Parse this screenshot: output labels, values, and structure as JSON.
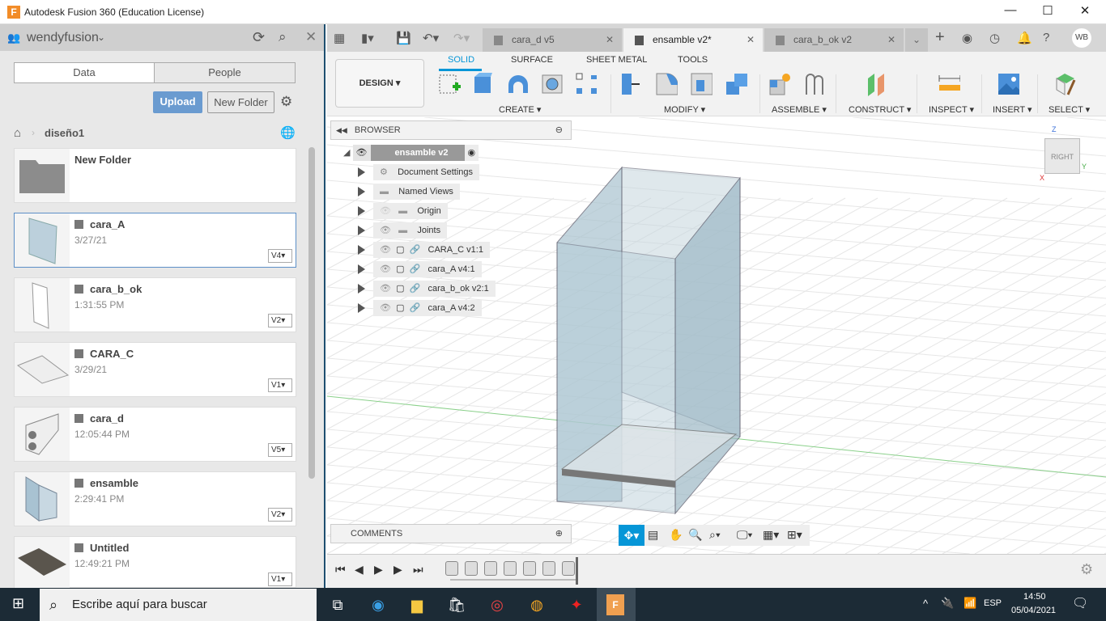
{
  "window": {
    "title": "Autodesk Fusion 360 (Education License)",
    "minimize": "—",
    "maximize": "☐",
    "close": "✕"
  },
  "data_panel": {
    "team": "wendyfusion",
    "tabs": [
      "Data",
      "People"
    ],
    "upload": "Upload",
    "new_folder": "New Folder",
    "breadcrumb": "diseño1",
    "items": [
      {
        "name": "New Folder",
        "date": "",
        "version": "",
        "type": "folder"
      },
      {
        "name": "cara_A",
        "date": "3/27/21",
        "version": "V4",
        "selected": true
      },
      {
        "name": "cara_b_ok",
        "date": "1:31:55 PM",
        "version": "V2"
      },
      {
        "name": "CARA_C",
        "date": "3/29/21",
        "version": "V1"
      },
      {
        "name": "cara_d",
        "date": "12:05:44 PM",
        "version": "V5"
      },
      {
        "name": "ensamble",
        "date": "2:29:41 PM",
        "version": "V2"
      },
      {
        "name": "Untitled",
        "date": "12:49:21 PM",
        "version": "V1"
      }
    ]
  },
  "doc_tabs": [
    {
      "label": "cara_d v5",
      "active": false
    },
    {
      "label": "ensamble v2*",
      "active": true
    },
    {
      "label": "cara_b_ok v2",
      "active": false
    }
  ],
  "user_initials": "WB",
  "toolbar": {
    "workspace": "DESIGN",
    "tabs": [
      "SOLID",
      "SURFACE",
      "SHEET METAL",
      "TOOLS"
    ],
    "active_tab": "SOLID",
    "groups": [
      "CREATE",
      "MODIFY",
      "ASSEMBLE",
      "CONSTRUCT",
      "INSPECT",
      "INSERT",
      "SELECT"
    ]
  },
  "browser": {
    "title": "BROWSER",
    "root": "ensamble v2",
    "nodes": [
      "Document Settings",
      "Named Views",
      "Origin",
      "Joints",
      "CARA_C v1:1",
      "cara_A v4:1",
      "cara_b_ok v2:1",
      "cara_A v4:2"
    ]
  },
  "comments": "COMMENTS",
  "viewcube": {
    "face": "RIGHT",
    "z": "Z",
    "y": "Y",
    "x": "X"
  },
  "accent": "#0696d7",
  "taskbar": {
    "search_placeholder": "Escribe aquí para buscar",
    "lang": "ESP",
    "time": "14:50",
    "date": "05/04/2021"
  }
}
